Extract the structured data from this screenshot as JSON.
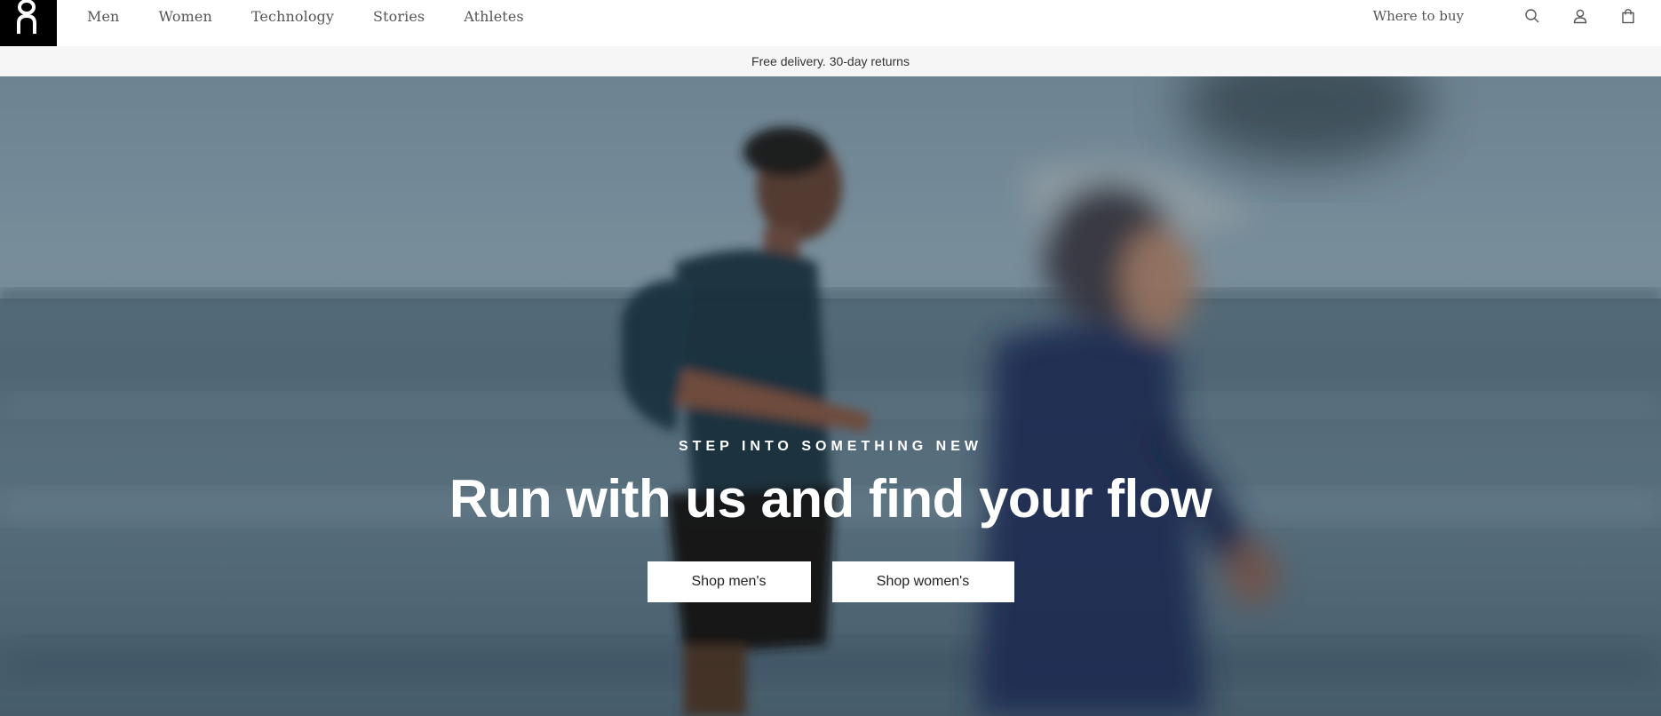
{
  "brand": {
    "logo_icon": "on-logo-icon",
    "color": "#000000"
  },
  "nav": {
    "items": [
      {
        "label": "Men"
      },
      {
        "label": "Women"
      },
      {
        "label": "Technology"
      },
      {
        "label": "Stories"
      },
      {
        "label": "Athletes"
      }
    ]
  },
  "header_right": {
    "where_to_buy": "Where to buy",
    "icons": [
      "search-icon",
      "account-icon",
      "cart-icon"
    ]
  },
  "promo": {
    "text": "Free delivery. 30-day returns"
  },
  "hero": {
    "eyebrow": "STEP INTO SOMETHING NEW",
    "headline": "Run with us and find your flow",
    "cta_men": "Shop men's",
    "cta_women": "Shop women's"
  },
  "colors": {
    "header_bg": "#ffffff",
    "promo_bg": "#f6f6f6",
    "cta_bg": "#ffffff",
    "hero_text": "#ffffff"
  }
}
